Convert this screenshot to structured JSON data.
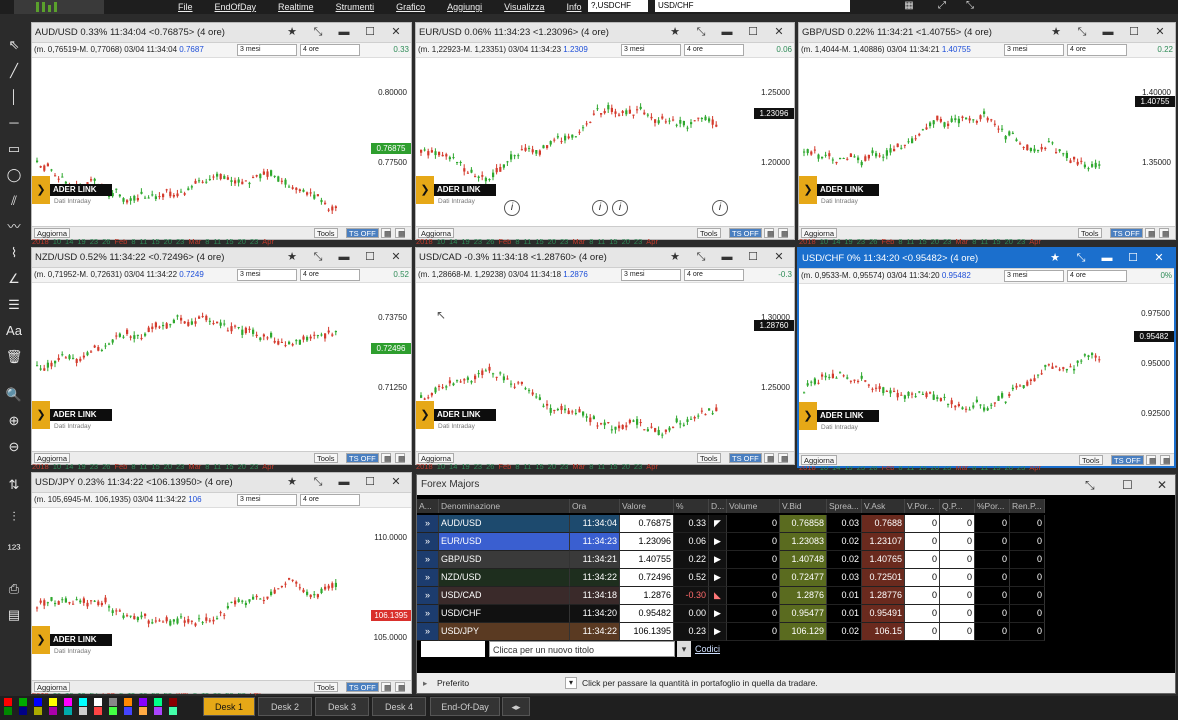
{
  "menu": [
    "File",
    "EndOfDay",
    "Realtime",
    "Strumenti",
    "Grafico",
    "Aggiungi",
    "Visualizza",
    "Info"
  ],
  "symbol_fields": [
    "?,USDCHF",
    "USD/CHF"
  ],
  "toolbar_icons": [
    "cursor-icon",
    "line-tool-icon",
    "vertical-line-icon",
    "horizontal-line-icon",
    "rectangle-icon",
    "ellipse-icon",
    "channel-icon",
    "freehand-icon",
    "fibonacci-icon",
    "gann-icon",
    "parallel-lines-icon",
    "text-icon",
    "trash-icon",
    "zoom-icon",
    "zoom-in-icon",
    "zoom-out-icon",
    "sort-icon",
    "candles-icon",
    "scale-icon",
    "print-icon",
    "save-icon"
  ],
  "charts": [
    {
      "title": "AUD/USD 0.33% 11:34:04 <0.76875> (4 ore)",
      "range": "(m. 0,76519-M. 0,77068) 03/04 11:34:04",
      "cur": "0.7687",
      "pct": "0.33",
      "period": "3 mesi",
      "interval": "4 ore",
      "y_labels": [
        "0.80000",
        "0.77500"
      ],
      "price_tag": "0.76875",
      "tag_color": "#2e9e2e",
      "x_labels": [
        "2018",
        "10",
        "14",
        "19",
        "23",
        "26",
        "Feb",
        "8",
        "11",
        "15",
        "20",
        "23",
        "Mar",
        "8",
        "11",
        "15",
        "20",
        "23",
        "Apr"
      ],
      "badge": "ADER LINK",
      "badge_sub": "Dati Intraday",
      "seed": 1
    },
    {
      "title": "EUR/USD 0.06% 11:34:23 <1.23096> (4 ore)",
      "range": "(m. 1,22923-M. 1,23351) 03/04 11:34:23",
      "cur": "1.2309",
      "pct": "0.06",
      "period": "3 mesi",
      "interval": "4 ore",
      "y_labels": [
        "1.25000",
        "1.20000"
      ],
      "price_tag": "1.23096",
      "tag_color": "#111111",
      "x_labels": [
        "2018",
        "10",
        "14",
        "19",
        "23",
        "26",
        "Feb",
        "8",
        "11",
        "15",
        "20",
        "23",
        "Mar",
        "8",
        "11",
        "15",
        "20",
        "23",
        "Apr"
      ],
      "badge": "ADER LINK",
      "badge_sub": "Dati Intraday",
      "seed": 2
    },
    {
      "title": "GBP/USD 0.22% 11:34:21 <1.40755> (4 ore)",
      "range": "(m. 1,4044-M. 1,40886) 03/04 11:34:21",
      "cur": "1.40755",
      "pct": "0.22",
      "period": "3 mesi",
      "interval": "4 ore",
      "y_labels": [
        "1.40000",
        "1.35000"
      ],
      "price_tag": "1.40755",
      "tag_color": "#111111",
      "x_labels": [
        "2018",
        "10",
        "14",
        "19",
        "23",
        "26",
        "Feb",
        "8",
        "11",
        "15",
        "20",
        "23",
        "Mar",
        "8",
        "11",
        "15",
        "20",
        "23",
        "Apr"
      ],
      "badge": "ADER LINK",
      "badge_sub": "Dati Intraday",
      "seed": 3
    },
    {
      "title": "NZD/USD 0.52% 11:34:22 <0.72496> (4 ore)",
      "range": "(m. 0,71952-M. 0,72631) 03/04 11:34:22",
      "cur": "0.7249",
      "pct": "0.52",
      "period": "3 mesi",
      "interval": "4 ore",
      "y_labels": [
        "0.73750",
        "0.71250"
      ],
      "price_tag": "0.72496",
      "tag_color": "#2e9e2e",
      "x_labels": [
        "2018",
        "10",
        "14",
        "19",
        "23",
        "26",
        "Feb",
        "8",
        "11",
        "15",
        "20",
        "23",
        "Mar",
        "8",
        "11",
        "15",
        "20",
        "23",
        "Apr"
      ],
      "badge": "ADER LINK",
      "badge_sub": "Dati Intraday",
      "seed": 4
    },
    {
      "title": "USD/CAD -0.3% 11:34:18 <1.28760> (4 ore)",
      "range": "(m. 1,28668-M. 1,29238) 03/04 11:34:18",
      "cur": "1.2876",
      "pct": "-0.3",
      "period": "3 mesi",
      "interval": "4 ore",
      "y_labels": [
        "1.30000",
        "1.25000"
      ],
      "price_tag": "1.28760",
      "tag_color": "#111111",
      "x_labels": [
        "2018",
        "10",
        "14",
        "19",
        "23",
        "26",
        "Feb",
        "8",
        "11",
        "15",
        "20",
        "23",
        "Mar",
        "8",
        "11",
        "15",
        "20",
        "23",
        "Apr"
      ],
      "badge": "ADER LINK",
      "badge_sub": "Dati Intraday",
      "seed": 5
    },
    {
      "title": "USD/CHF 0% 11:34:20 <0.95482> (4 ore)",
      "range": "(m. 0,9533-M. 0,95574) 03/04 11:34:20",
      "cur": "0.95482",
      "pct": "0%",
      "period": "3 mesi",
      "interval": "4 ore",
      "y_labels": [
        "0.97500",
        "0.95000",
        "0.92500"
      ],
      "price_tag": "0.95482",
      "tag_color": "#111111",
      "x_labels": [
        "2018",
        "10",
        "14",
        "19",
        "23",
        "26",
        "Feb",
        "8",
        "11",
        "15",
        "20",
        "23",
        "Mar",
        "8",
        "11",
        "15",
        "20",
        "23",
        "Apr"
      ],
      "badge": "ADER LINK",
      "badge_sub": "Dati Intraday",
      "seed": 6
    },
    {
      "title": "USD/JPY 0.23% 11:34:22 <106.13950> (4 ore)",
      "range": "(m. 105,6945-M. 106,1935) 03/04 11:34:22",
      "cur": "106",
      "pct": "",
      "period": "3 mesi",
      "interval": "4 ore",
      "y_labels": [
        "110.0000",
        "106.1395",
        "105.0000"
      ],
      "price_tag": "106.1395",
      "tag_color": "#d9302c",
      "x_labels": [
        "2018",
        "10",
        "15",
        "19",
        "24",
        "Feb",
        "8",
        "11",
        "15",
        "20",
        "25",
        "Mar",
        "8",
        "11",
        "15",
        "20",
        "25",
        "Apr"
      ],
      "badge": "ADER LINK",
      "badge_sub": "Dati Intraday",
      "seed": 7
    }
  ],
  "chart_footer": {
    "aggiorna": "Aggiorna",
    "tools": "Tools",
    "tsoff": "TS OFF"
  },
  "forex": {
    "title": "Forex Majors",
    "columns": [
      "A...",
      "Denominazione",
      "Ora",
      "Valore",
      "%",
      "D...",
      "Volume",
      "V.Bid",
      "Sprea...",
      "V.Ask",
      "V.Por...",
      "Q.P...",
      "%Por...",
      "Ren.P..."
    ],
    "rows": [
      {
        "name": "AUD/USD",
        "ora": "11:34:04",
        "val": "0.76875",
        "pct": "0.33",
        "vol": "0",
        "vbid": "0.76858",
        "spread": "0.03",
        "vask": "0.7688",
        "vp": "0",
        "qp": "0",
        "pp": "0",
        "rp": "0",
        "bg": "#1d4a6e"
      },
      {
        "name": "EUR/USD",
        "ora": "11:34:23",
        "val": "1.23096",
        "pct": "0.06",
        "vol": "0",
        "vbid": "1.23083",
        "spread": "0.02",
        "vask": "1.23107",
        "vp": "0",
        "qp": "0",
        "pp": "0",
        "rp": "0",
        "bg": "#3a5fd0"
      },
      {
        "name": "GBP/USD",
        "ora": "11:34:21",
        "val": "1.40755",
        "pct": "0.22",
        "vol": "0",
        "vbid": "1.40748",
        "spread": "0.02",
        "vask": "1.40765",
        "vp": "0",
        "qp": "0",
        "pp": "0",
        "rp": "0",
        "bg": "#3a3a3a"
      },
      {
        "name": "NZD/USD",
        "ora": "11:34:22",
        "val": "0.72496",
        "pct": "0.52",
        "vol": "0",
        "vbid": "0.72477",
        "spread": "0.03",
        "vask": "0.72501",
        "vp": "0",
        "qp": "0",
        "pp": "0",
        "rp": "0",
        "bg": "#1e2e1e"
      },
      {
        "name": "USD/CAD",
        "ora": "11:34:18",
        "val": "1.2876",
        "pct": "-0.30",
        "vol": "0",
        "vbid": "1.2876",
        "spread": "0.01",
        "vask": "1.28776",
        "vp": "0",
        "qp": "0",
        "pp": "0",
        "rp": "0",
        "bg": "#3a2a2a"
      },
      {
        "name": "USD/CHF",
        "ora": "11:34:20",
        "val": "0.95482",
        "pct": "0.00",
        "vol": "0",
        "vbid": "0.95477",
        "spread": "0.01",
        "vask": "0.95491",
        "vp": "0",
        "qp": "0",
        "pp": "0",
        "rp": "0",
        "bg": "#111111"
      },
      {
        "name": "USD/JPY",
        "ora": "11:34:22",
        "val": "106.1395",
        "pct": "0.23",
        "vol": "0",
        "vbid": "106.129",
        "spread": "0.02",
        "vask": "106.15",
        "vp": "0",
        "qp": "0",
        "pp": "0",
        "rp": "0",
        "bg": "#5a3a22"
      }
    ],
    "new_title_placeholder": "Clicca per un nuovo titolo",
    "codici": "Codici",
    "footer_pref": "Preferito",
    "footer_hint": "Click per passare la quantità in portafoglio in quella da tradare."
  },
  "desks": [
    "Desk 1",
    "Desk 2",
    "Desk 3",
    "Desk 4",
    "End-Of-Day"
  ],
  "palette": [
    "#ff0000",
    "#00aa00",
    "#0000ff",
    "#ffff00",
    "#ff00ff",
    "#00ffff",
    "#ffffff",
    "#888888",
    "#ff8800",
    "#8800ff",
    "#00ff88",
    "#880000",
    "#008800",
    "#000088",
    "#aaaa00",
    "#aa00aa",
    "#00aaaa",
    "#cccccc",
    "#ff4444",
    "#44ff44",
    "#4444ff",
    "#ffaa44",
    "#aa44ff",
    "#44ffaa"
  ]
}
